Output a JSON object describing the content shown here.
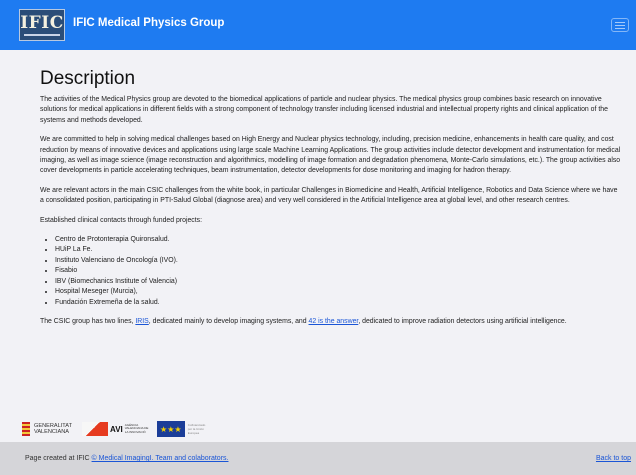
{
  "navbar": {
    "logo_text": "IFIC",
    "brand": "IFIC Medical Physics Group"
  },
  "main": {
    "title": "Description",
    "paragraphs": [
      "The activities of the Medical Physics group are devoted to the biomedical applications of particle and nuclear physics. The medical physics group combines basic research on innovative solutions for medical applications in different fields with a strong component of technology transfer including licensed industrial and intellectual property rights and clinical application of the systems and methods developed.",
      "We are committed to help in solving medical challenges based on High Energy and Nuclear physics technology, including, precision medicine, enhancements in health care quality, and cost reduction by means of innovative devices and applications using large scale Machine Learning Applications. The group activities include detector development and instrumentation for medical imaging, as well as image science (image reconstruction and algorithmics, modelling of image formation and degradation phenomena, Monte-Carlo simulations, etc.). The group activities also cover developments in particle accelerating techniques, beam instrumentation, detector developments for dose monitoring and imaging for hadron therapy.",
      "We are relevant actors in the main CSIC challenges from the white book, in particular Challenges in Biomedicine and Health, Artificial Intelligence, Robotics and Data Science where we have a consolidated position, participating in PTI-Salud Global (diagnose area) and very well considered in the Artificial Intelligence area at global level, and other research centres.",
      "Established clinical contacts through funded projects:"
    ],
    "contacts": [
      "Centro de Protonterapia Quironsalud.",
      "HUiP La Fe.",
      "Instituto Valenciano de Oncología (IVO).",
      "Fisabio",
      "IBV (Biomechanics Institute of Valencia)",
      "Hospital Meseger (Murcia),",
      "Fundación Extremeña de la salud."
    ],
    "closing": {
      "pre": "The CSIC group has two lines, ",
      "link1": "IRIS",
      "mid": ", dedicated mainly to develop imaging systems, and ",
      "link2": "42 is the answer",
      "post": ", dedicated to improve radiation detectors using artificial intelligence."
    }
  },
  "sponsors": {
    "gva_line1": "GENERALITAT",
    "gva_line2": "VALENCIANA",
    "avi": "AVI",
    "avi_sub": "AGÈNCIA VALENCIANA DE LA INNOVACIÓ",
    "eu_stars": "★★★",
    "eu_sub": "Cofinanciado por la Unión Europea"
  },
  "footer": {
    "prefix": "Page created at IFIC ",
    "link": "© Medical ImagingI. Team and colaborators.",
    "back_to_top": "Back to top"
  }
}
